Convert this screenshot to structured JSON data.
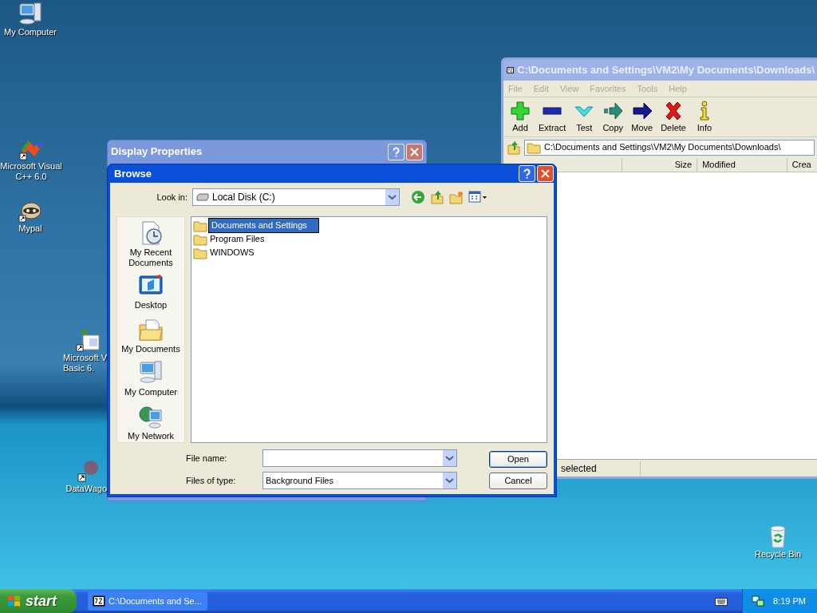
{
  "desktop_icons": [
    {
      "kind": "computer",
      "lines": [
        "My Computer"
      ]
    },
    {
      "kind": "studio",
      "lines": [
        "Microsoft Visual",
        "C++ 6.0"
      ]
    },
    {
      "kind": "raccoon",
      "lines": [
        "Mypal"
      ]
    },
    {
      "kind": "basic",
      "lines": [
        "Microsoft V",
        "Basic 6."
      ]
    },
    {
      "kind": "wagon",
      "lines": [
        "DataWago"
      ]
    },
    {
      "kind": "recycle",
      "lines": [
        "Recycle Bin"
      ]
    }
  ],
  "archiver_window": {
    "title": "C:\\Documents and Settings\\VM2\\My Documents\\Downloads\\",
    "menu": [
      "File",
      "Edit",
      "View",
      "Favorites",
      "Tools",
      "Help"
    ],
    "toolbar": [
      {
        "kind": "add",
        "label": "Add"
      },
      {
        "kind": "extract",
        "label": "Extract"
      },
      {
        "kind": "test",
        "label": "Test"
      },
      {
        "kind": "copy",
        "label": "Copy"
      },
      {
        "kind": "move",
        "label": "Move"
      },
      {
        "kind": "delete",
        "label": "Delete"
      },
      {
        "kind": "info",
        "label": "Info"
      }
    ],
    "address": "C:\\Documents and Settings\\VM2\\My Documents\\Downloads\\",
    "columns": [
      "Size",
      "Modified",
      "Crea"
    ],
    "status": "selected"
  },
  "display_properties": {
    "title": "Display Properties"
  },
  "browse_dialog": {
    "title": "Browse",
    "look_in_label": "Look in:",
    "look_in_value": "Local Disk (C:)",
    "places": [
      {
        "kind": "recent",
        "lines": [
          "My Recent",
          "Documents"
        ]
      },
      {
        "kind": "desktop",
        "lines": [
          "Desktop"
        ]
      },
      {
        "kind": "documents",
        "lines": [
          "My Documents"
        ]
      },
      {
        "kind": "computer",
        "lines": [
          "My Computer"
        ]
      },
      {
        "kind": "network",
        "lines": [
          "My Network"
        ]
      }
    ],
    "files": [
      {
        "name": "Documents and Settings",
        "selected": true
      },
      {
        "name": "Program Files",
        "selected": false
      },
      {
        "name": "WINDOWS",
        "selected": false
      }
    ],
    "file_name_label": "File name:",
    "files_of_type_label": "Files of type:",
    "files_of_type_value": "Background Files",
    "buttons": [
      {
        "label": "Open",
        "default": true
      },
      {
        "label": "Cancel",
        "default": false
      }
    ]
  },
  "taskbar": {
    "start": "start",
    "tasks": [
      {
        "label": "C:\\Documents and Se..."
      }
    ],
    "clock": "8:19 PM"
  }
}
